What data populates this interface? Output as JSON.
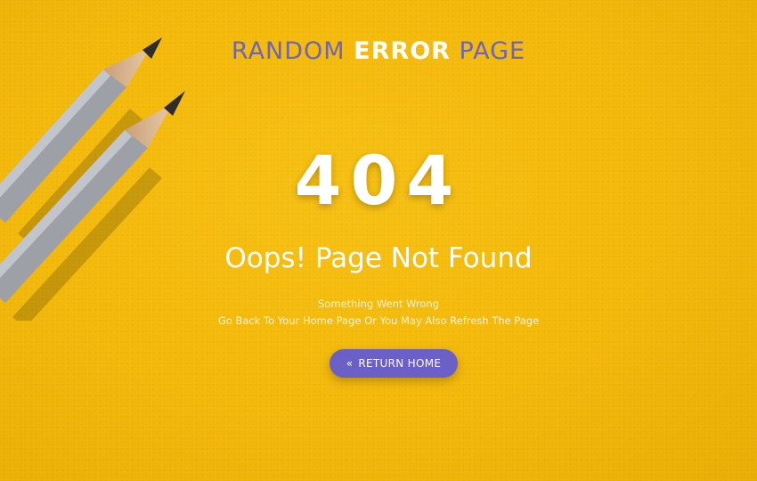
{
  "title": {
    "part1": "RANDOM",
    "emphasis": "ERROR",
    "part2": "PAGE"
  },
  "error": {
    "code": "404",
    "headline": "Oops! Page Not Found",
    "line1": "Something Went Wrong",
    "line2": "Go Back To Your Home Page Or You May Also Refresh The Page"
  },
  "button": {
    "icon": "double-chevron-left-icon",
    "label": "RETURN HOME"
  },
  "colors": {
    "background": "#f2b80a",
    "accent": "#6b60c7",
    "title": "#6f64b8",
    "text": "#ffffff"
  },
  "decor": {
    "image": "pencils"
  }
}
